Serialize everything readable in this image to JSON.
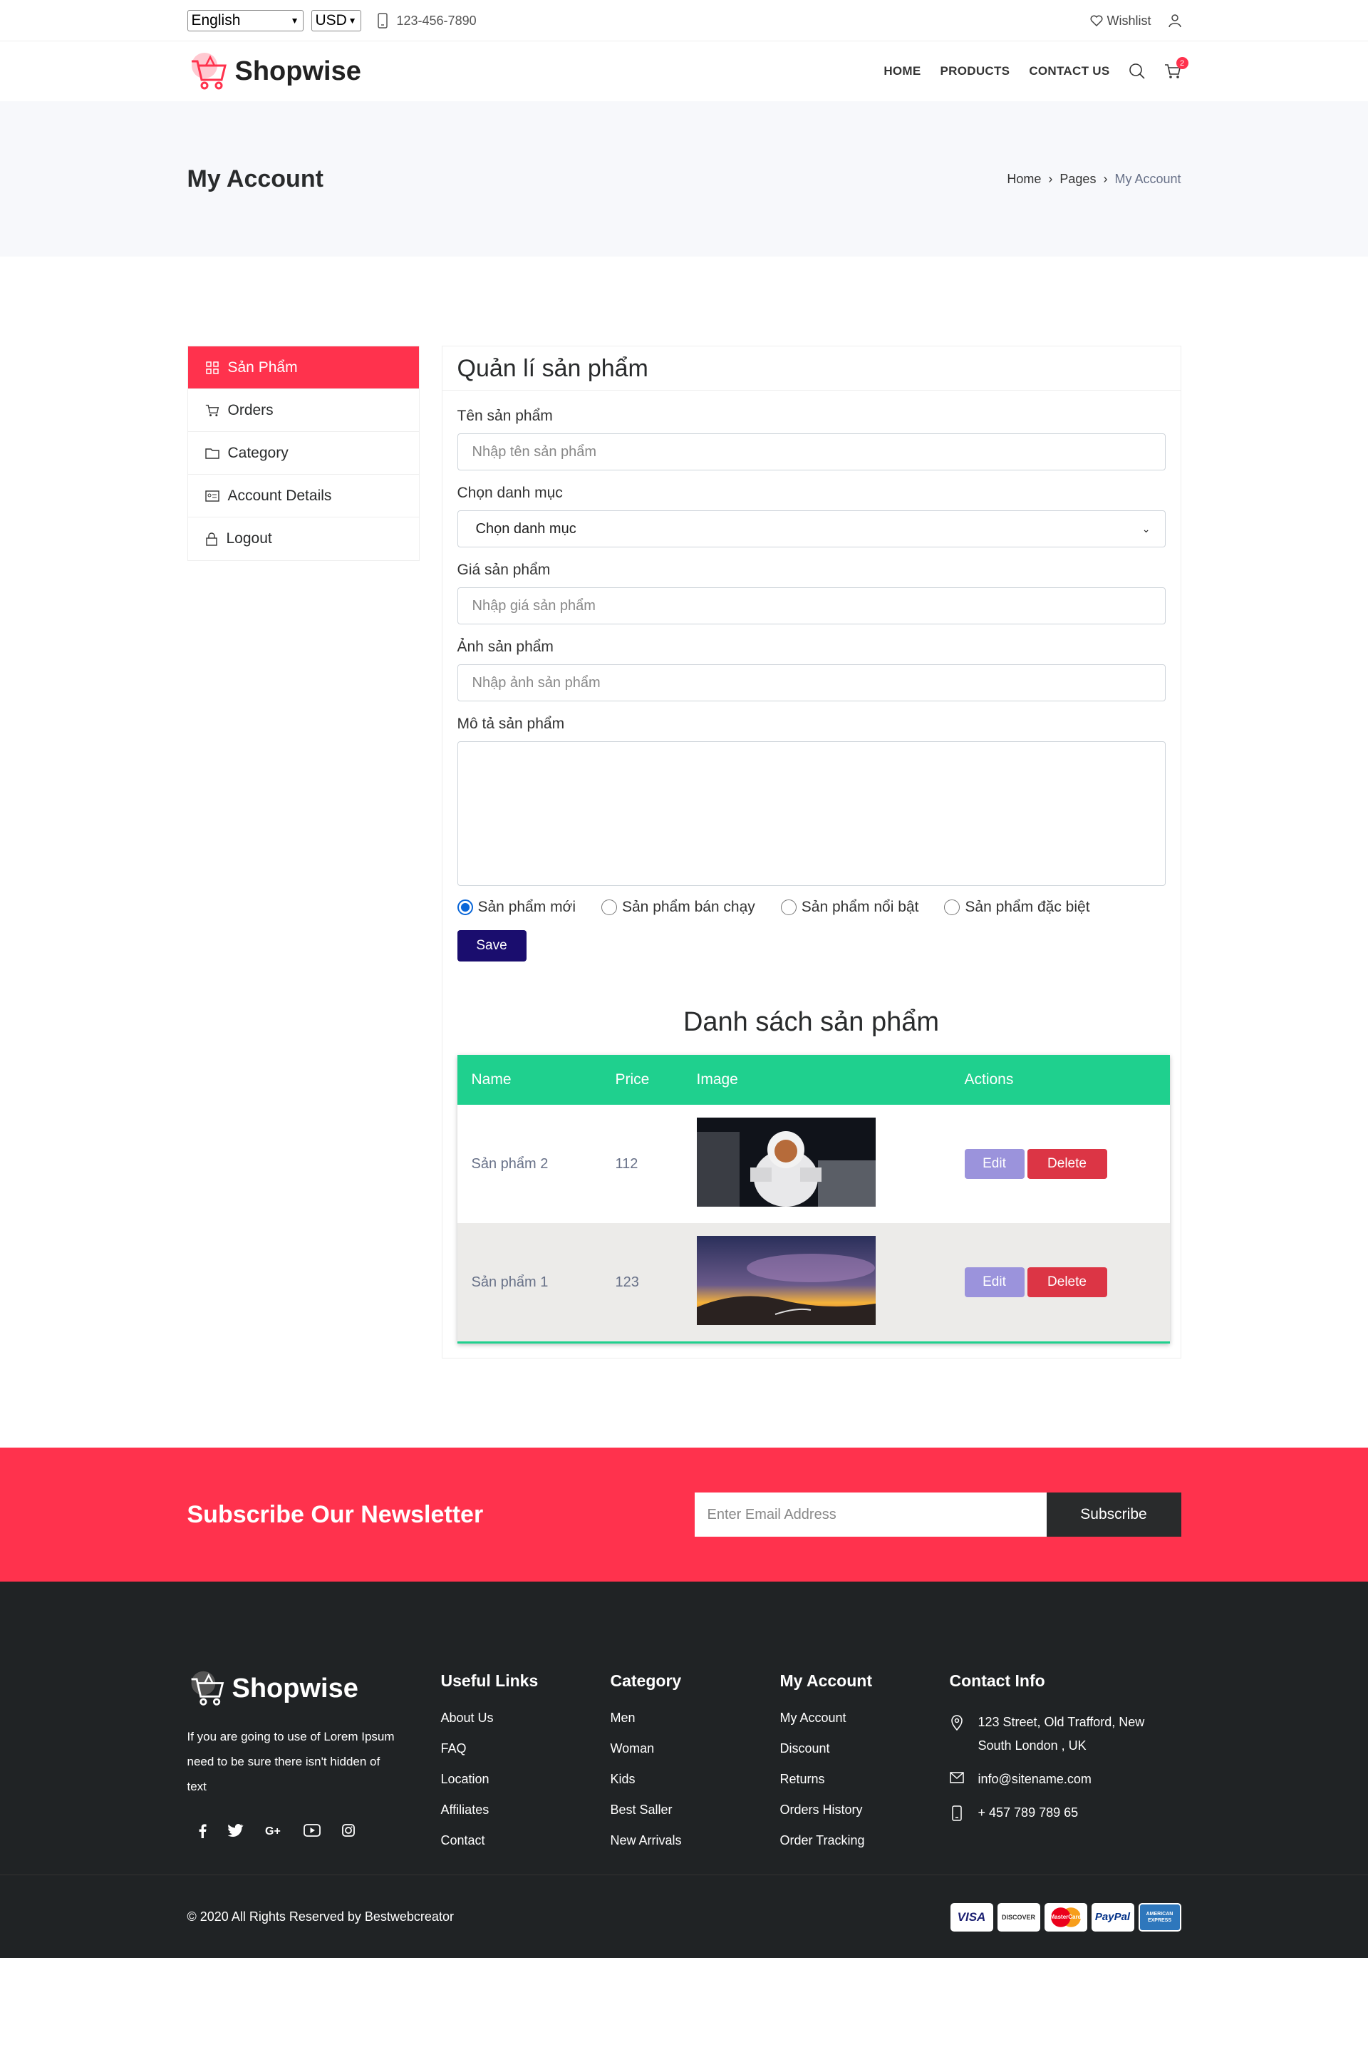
{
  "topbar": {
    "language": "English",
    "currency": "USD",
    "phone": "123-456-7890",
    "wishlist": "Wishlist"
  },
  "header": {
    "logo": "Shopwise",
    "nav": [
      "HOME",
      "PRODUCTS",
      "CONTACT US"
    ],
    "cart_count": "2"
  },
  "page_title": {
    "title": "My Account",
    "breadcrumb": [
      "Home",
      "Pages",
      "My Account"
    ]
  },
  "sidebar": {
    "items": [
      {
        "label": "Sản Phẩm",
        "icon": "grid-icon",
        "active": true
      },
      {
        "label": "Orders",
        "icon": "cart-icon"
      },
      {
        "label": "Category",
        "icon": "folder-icon"
      },
      {
        "label": "Account Details",
        "icon": "id-card-icon"
      },
      {
        "label": "Logout",
        "icon": "lock-icon"
      }
    ]
  },
  "form": {
    "heading": "Quản lí sản phẩm",
    "name_label": "Tên sản phẩm",
    "name_placeholder": "Nhập tên sản phẩm",
    "category_label": "Chọn danh mục",
    "category_value": "Chọn danh mục",
    "price_label": "Giá sản phẩm",
    "price_placeholder": "Nhập giá sản phẩm",
    "image_label": "Ảnh sản phẩm",
    "image_placeholder": "Nhập ảnh sản phẩm",
    "desc_label": "Mô tả sản phẩm",
    "radios": [
      {
        "label": "Sản phẩm mới",
        "checked": true
      },
      {
        "label": "Sản phẩm bán chạy",
        "checked": false
      },
      {
        "label": "Sản phẩm nổi bật",
        "checked": false
      },
      {
        "label": "Sản phẩm đặc biệt",
        "checked": false
      }
    ],
    "save": "Save"
  },
  "list": {
    "heading": "Danh sách sản phẩm",
    "columns": [
      "Name",
      "Price",
      "Image",
      "Actions"
    ],
    "rows": [
      {
        "name": "Sản phẩm 2",
        "price": "112"
      },
      {
        "name": "Sản phẩm 1",
        "price": "123"
      }
    ],
    "edit": "Edit",
    "delete": "Delete"
  },
  "newsletter": {
    "title": "Subscribe Our Newsletter",
    "placeholder": "Enter Email Address",
    "button": "Subscribe"
  },
  "footer": {
    "logo": "Shopwise",
    "desc": "If you are going to use of Lorem Ipsum need to be sure there isn't hidden of text",
    "useful": {
      "title": "Useful Links",
      "links": [
        "About Us",
        "FAQ",
        "Location",
        "Affiliates",
        "Contact"
      ]
    },
    "category": {
      "title": "Category",
      "links": [
        "Men",
        "Woman",
        "Kids",
        "Best Saller",
        "New Arrivals"
      ]
    },
    "account": {
      "title": "My Account",
      "links": [
        "My Account",
        "Discount",
        "Returns",
        "Orders History",
        "Order Tracking"
      ]
    },
    "contact": {
      "title": "Contact Info",
      "address": "123 Street, Old Trafford, New South London , UK",
      "email": "info@sitename.com",
      "phone": "+ 457 789 789 65"
    },
    "copyright": "© 2020 All Rights Reserved by Bestwebcreator",
    "cards": [
      "VISA",
      "DISCOVER",
      "MasterCard",
      "PayPal",
      "AMERICAN EXPRESS"
    ]
  },
  "colors": {
    "accent": "#ff324d",
    "table_header": "#1fd08e",
    "save": "#1a0d6e",
    "footer": "#202325"
  }
}
